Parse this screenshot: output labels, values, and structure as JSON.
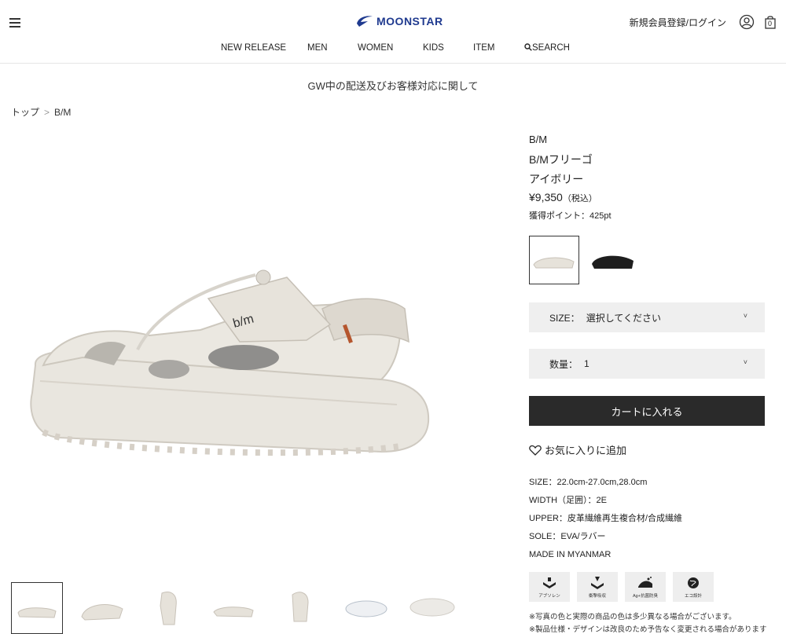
{
  "header": {
    "logo_text": "MOONSTAR",
    "account_link": "新規会員登録/ログイン",
    "cart_count": "0",
    "nav": [
      "NEW RELEASE",
      "MEN",
      "WOMEN",
      "KIDS",
      "ITEM",
      "SEARCH"
    ]
  },
  "notice": "GW中の配送及びお客様対応に関して",
  "breadcrumb": {
    "home": "トップ",
    "sep": ">",
    "current": "B/M"
  },
  "product": {
    "brand": "B/M",
    "name": "B/Mフリーゴ",
    "color": "アイボリー",
    "price": "¥9,350",
    "tax_note": "（税込）",
    "points": "獲得ポイント：425pt"
  },
  "size_select": {
    "label": "SIZE：",
    "value": "選択してください"
  },
  "qty_select": {
    "label": "数量：",
    "value": "1"
  },
  "cart_button": "カートに入れる",
  "favorite": "お気に入りに追加",
  "specs": [
    "SIZE：22.0cm-27.0cm,28.0cm",
    "WIDTH（足囲）：2E",
    "UPPER：皮革繊維再生複合材/合成繊維",
    "SOLE：EVA/ラバー",
    "MADE IN MYANMAR"
  ],
  "features": [
    "アブソレン",
    "衝撃吸収",
    "Ag+抗菌防臭",
    "エコ設計"
  ],
  "notes": [
    "※写真の色と実際の商品の色は多少異なる場合がございます。",
    "※製品仕様・デザインは改良のため予告なく変更される場合があります"
  ],
  "colors": {
    "dark_button": "#2a2a2a",
    "select_bg": "#efefef",
    "logo_blue": "#1f3a8f"
  }
}
